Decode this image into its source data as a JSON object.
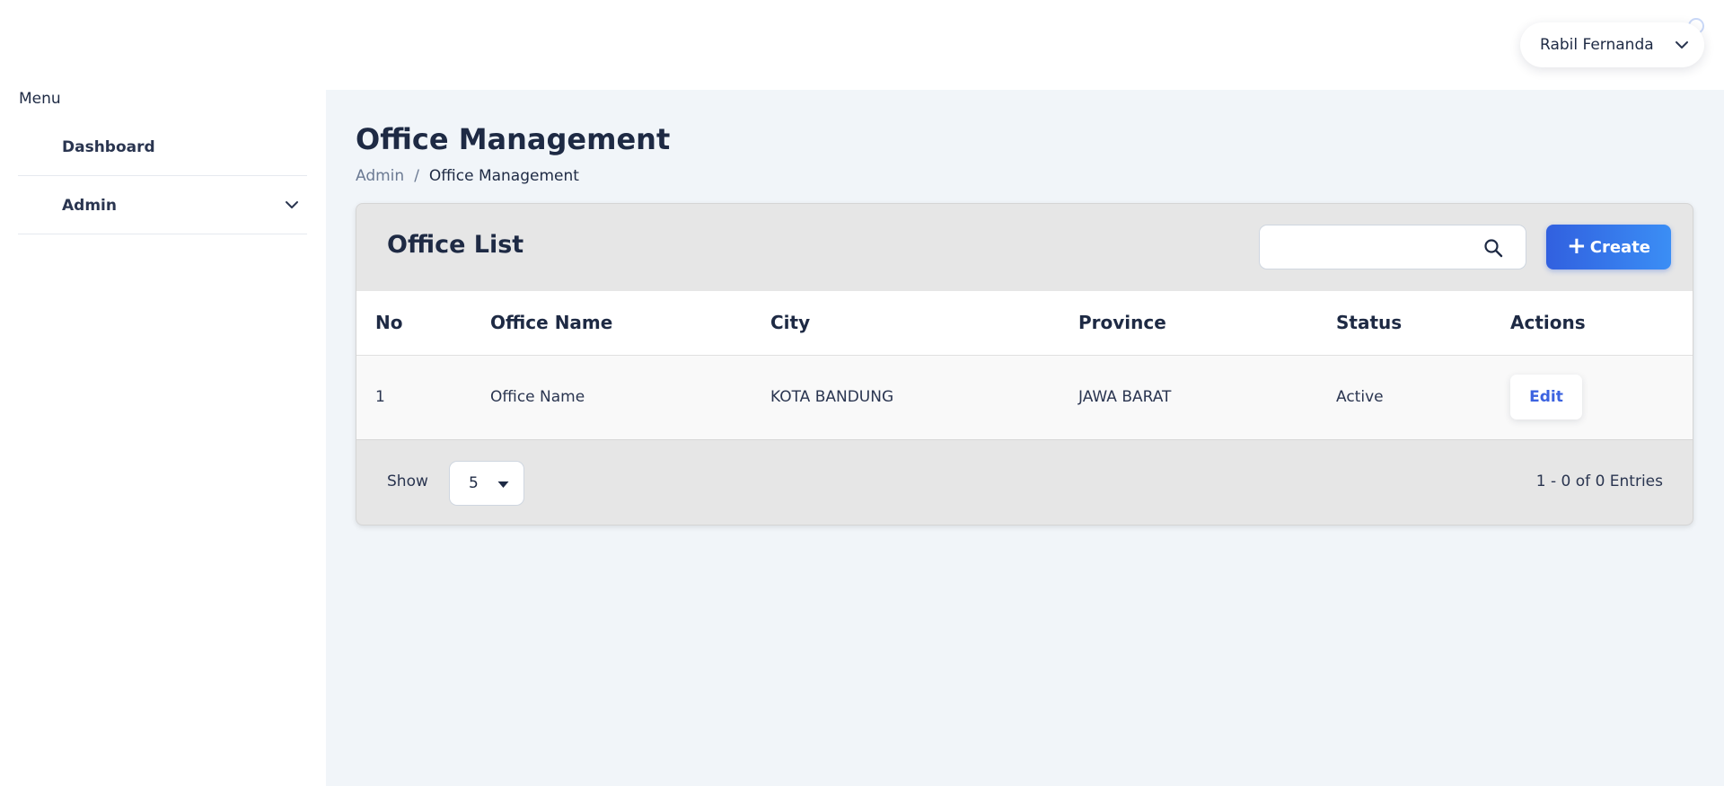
{
  "user": {
    "name": "Rabil Fernanda"
  },
  "sidebar": {
    "title": "Menu",
    "items": [
      {
        "label": "Dashboard"
      },
      {
        "label": "Admin"
      }
    ]
  },
  "page": {
    "title": "Office Management",
    "breadcrumb": [
      "Admin",
      "/",
      "Office Management"
    ]
  },
  "card": {
    "title": "Office List",
    "search": {
      "placeholder": "",
      "value": ""
    },
    "create_label": "Create",
    "create_icon": "plus-icon"
  },
  "table": {
    "columns": [
      "No",
      "Office Name",
      "City",
      "Province",
      "Status",
      "Actions"
    ],
    "rows": [
      {
        "no": "1",
        "office_name": "Office Name",
        "city": "KOTA BANDUNG",
        "province": "JAWA BARAT",
        "status": "Active",
        "action": "Edit"
      }
    ]
  },
  "footer": {
    "show_label": "Show",
    "page_size": "5",
    "entries_text": "1 - 0 of 0 Entries"
  },
  "colors": {
    "primary": "#3160df",
    "accent": "#3b8ef5",
    "text": "#1e2a44",
    "background": "#f1f5f9",
    "card": "#e6e6e6",
    "link": "#3c63e0"
  }
}
